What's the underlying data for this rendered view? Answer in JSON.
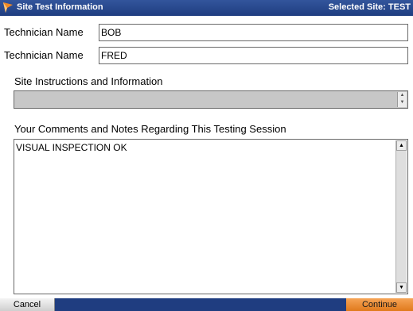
{
  "titlebar": {
    "title": "Site Test Information",
    "selected_site": "Selected Site: TEST"
  },
  "technicians": [
    {
      "label": "Technician Name",
      "value": "BOB"
    },
    {
      "label": "Technician Name",
      "value": "FRED"
    }
  ],
  "instructions": {
    "heading": "Site Instructions and Information",
    "value": ""
  },
  "comments": {
    "heading": "Your Comments and Notes Regarding This Testing Session",
    "value": "VISUAL INSPECTION OK"
  },
  "footer": {
    "cancel_label": "Cancel",
    "continue_label": "Continue"
  },
  "colors": {
    "titlebar": "#1f3d80",
    "continue_button": "#e07a1c",
    "instructions_fill": "#c7c7c7"
  },
  "icons": {
    "app_logo": "arrow-logo-icon",
    "scroll_up": "scroll-up-arrow-icon",
    "scroll_down": "scroll-down-arrow-icon"
  }
}
